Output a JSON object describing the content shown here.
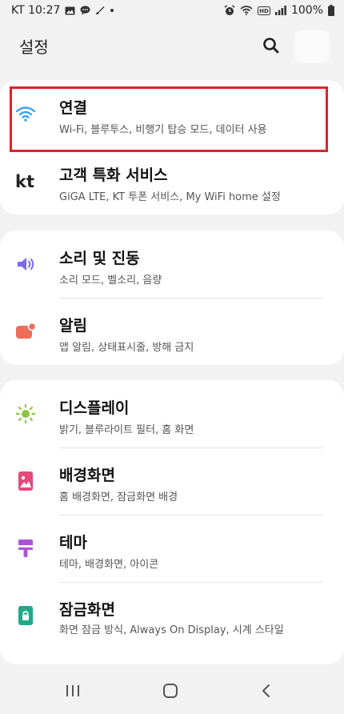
{
  "status_bar": {
    "carrier_time": "KT 10:27",
    "battery": "100%",
    "left_icons": [
      "gallery-icon",
      "chat-icon",
      "brush-icon",
      "dot-icon"
    ],
    "right_icons": [
      "alarm-icon",
      "wifi-icon",
      "hd-icon",
      "signal-icon",
      "battery-icon"
    ]
  },
  "header": {
    "title": "설정",
    "search_icon": "search-icon"
  },
  "groups": [
    {
      "items": [
        {
          "icon": "wifi-icon",
          "title": "연결",
          "subtitle": "Wi-Fi, 블루투스, 비행기 탑승 모드, 데이터 사용",
          "icon_color": "#3aa3e8"
        },
        {
          "icon": "kt-logo-icon",
          "title": "고객 특화 서비스",
          "subtitle": "GiGA LTE, KT 투폰 서비스, My WiFi home 설정",
          "icon_color": "#222222"
        }
      ]
    },
    {
      "items": [
        {
          "icon": "speaker-icon",
          "title": "소리 및 진동",
          "subtitle": "소리 모드, 벨소리, 음량",
          "icon_color": "#7a6cf0"
        },
        {
          "icon": "notification-icon",
          "title": "알림",
          "subtitle": "앱 알림, 상태표시줄, 방해 금지",
          "icon_color": "#ef6b5a"
        }
      ]
    },
    {
      "items": [
        {
          "icon": "brightness-icon",
          "title": "디스플레이",
          "subtitle": "밝기, 블루라이트 필터, 홈 화면",
          "icon_color": "#8cc63f"
        },
        {
          "icon": "wallpaper-icon",
          "title": "배경화면",
          "subtitle": "홈 배경화면, 잠금화면 배경",
          "icon_color": "#e8497a"
        },
        {
          "icon": "theme-brush-icon",
          "title": "테마",
          "subtitle": "테마, 배경화면, 아이콘",
          "icon_color": "#a855d6"
        },
        {
          "icon": "lock-icon",
          "title": "잠금화면",
          "subtitle": "화면 잠금 방식, Always On Display, 시계 스타일",
          "icon_color": "#1fa98a"
        }
      ]
    }
  ],
  "navbar": {
    "recents_icon": "recents-icon",
    "home_icon": "home-icon",
    "back_icon": "back-icon"
  },
  "colors": {
    "background": "#f2f2f2",
    "card": "#ffffff",
    "highlight": "#e0222a"
  }
}
